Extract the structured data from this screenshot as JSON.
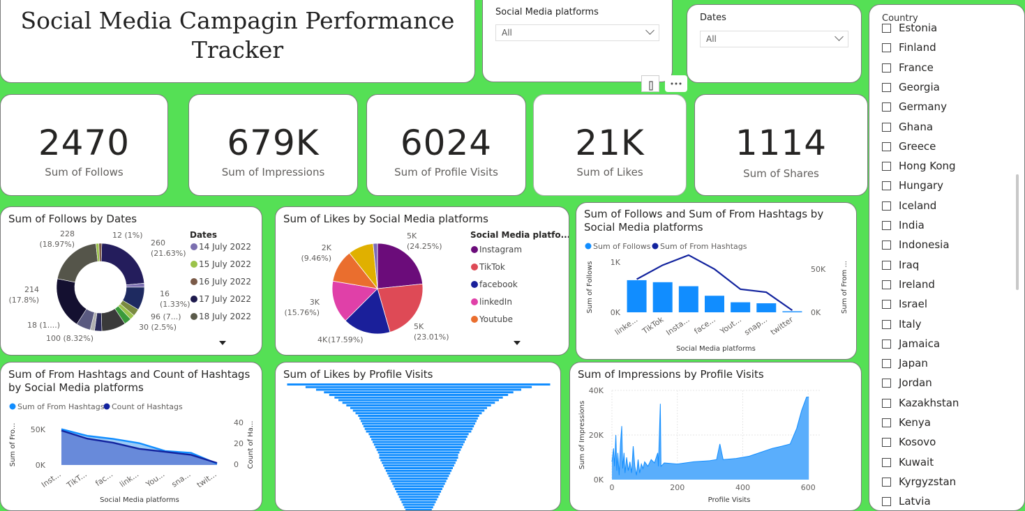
{
  "title": "Social Media Campagin Performance Tracker",
  "title_lines": [
    "Social Media Campagin Performance",
    "Tracker"
  ],
  "slicers": {
    "platforms": {
      "label": "Social Media platforms",
      "value": "All"
    },
    "dates": {
      "label": "Dates",
      "value": "All"
    }
  },
  "kpis": [
    {
      "value": "2470",
      "label": "Sum of Follows"
    },
    {
      "value": "679K",
      "label": "Sum of Impressions"
    },
    {
      "value": "6024",
      "label": "Sum of Profile Visits"
    },
    {
      "value": "21K",
      "label": "Sum of Likes"
    },
    {
      "value": "1114",
      "label": "Sum of Shares"
    }
  ],
  "country": {
    "label": "Country",
    "items": [
      "Estonia",
      "Finland",
      "France",
      "Georgia",
      "Germany",
      "Ghana",
      "Greece",
      "Hong Kong",
      "Hungary",
      "Iceland",
      "India",
      "Indonesia",
      "Iraq",
      "Ireland",
      "Israel",
      "Italy",
      "Jamaica",
      "Japan",
      "Jordan",
      "Kazakhstan",
      "Kenya",
      "Kosovo",
      "Kuwait",
      "Kyrgyzstan",
      "Latvia"
    ]
  },
  "icons": {
    "filter": "filter-icon",
    "more": "more-options-icon",
    "expand": "expand-legend-icon"
  },
  "chart_data": [
    {
      "type": "pie",
      "subtype": "donut",
      "title": "Sum of Follows by Dates",
      "legend_title": "Dates",
      "legend": [
        "14 July 2022",
        "15 July 2022",
        "16 July 2022",
        "17 July 2022",
        "18 July 2022"
      ],
      "colors": {
        "14 July 2022": "#7b6fb0",
        "15 July 2022": "#9bc34a",
        "16 July 2022": "#7a5a48",
        "17 July 2022": "#1e1a4d",
        "18 July 2022": "#5a5a4a"
      },
      "slices": [
        {
          "label": "260",
          "pct": "(21.63%)",
          "value": 260,
          "color": "#241d5c"
        },
        {
          "label": "16",
          "pct": "(1.33%)",
          "value": 16,
          "color": "#7b6fb0"
        },
        {
          "label": "96 (7...)",
          "pct": "",
          "value": 96,
          "color": "#1e2a60"
        },
        {
          "label": "30 (2.5%)",
          "pct": "",
          "value": 30,
          "color": "#7a8a40"
        },
        {
          "label": "",
          "pct": "",
          "value": 20,
          "color": "#9bc34a"
        },
        {
          "label": "",
          "pct": "",
          "value": 30,
          "color": "#3a9a3a"
        },
        {
          "label": "100 (8.32%)",
          "pct": "",
          "value": 100,
          "color": "#3a3a3a"
        },
        {
          "label": "",
          "pct": "",
          "value": 30,
          "color": "#2a2a5a"
        },
        {
          "label": "18 (1....)",
          "pct": "",
          "value": 18,
          "color": "#b0b0b0"
        },
        {
          "label": "",
          "pct": "",
          "value": 60,
          "color": "#5a5a80"
        },
        {
          "label": "214",
          "pct": "(17.8%)",
          "value": 214,
          "color": "#141030"
        },
        {
          "label": "228",
          "pct": "(18.97%)",
          "value": 228,
          "color": "#55554a"
        },
        {
          "label": "",
          "pct": "",
          "value": 12,
          "color": "#9bc34a"
        },
        {
          "label": "12 (1%)",
          "pct": "",
          "value": 12,
          "color": "#7a5a48"
        }
      ]
    },
    {
      "type": "pie",
      "title": "Sum of Likes by Social Media platforms",
      "legend_title": "Social Media platfo...",
      "legend": [
        "Instagram",
        "TikTok",
        "facebook",
        "linkedIn",
        "Youtube"
      ],
      "colors": {
        "Instagram": "#6b0c7a",
        "TikTok": "#de4a56",
        "facebook": "#1a1f9a",
        "linkedIn": "#e040a8",
        "Youtube": "#ea6e2e",
        "snapchat": "#e0b000",
        "twitter": "#7a6ab8"
      },
      "slices": [
        {
          "name": "Instagram",
          "value": 5000,
          "pct": "(24.25%)",
          "label": "5K",
          "color": "#6b0c7a"
        },
        {
          "name": "TikTok",
          "value": 4750,
          "pct": "(23.01%)",
          "label": "5K",
          "color": "#de4a56"
        },
        {
          "name": "facebook",
          "value": 3630,
          "pct": "(17.59%)",
          "label": "4K",
          "color": "#1a1f9a"
        },
        {
          "name": "linkedIn",
          "value": 3250,
          "pct": "(15.76%)",
          "label": "3K",
          "color": "#e040a8"
        },
        {
          "name": "Youtube",
          "value": 2500,
          "pct": "",
          "label": "",
          "color": "#ea6e2e"
        },
        {
          "name": "snapchat",
          "value": 1950,
          "pct": "(9.46%)",
          "label": "2K",
          "color": "#e0b000"
        },
        {
          "name": "twitter",
          "value": 330,
          "pct": "",
          "label": "",
          "color": "#7a6ab8"
        }
      ]
    },
    {
      "type": "bar",
      "title": "Sum of Follows and Sum of From Hashtags by Social Media platforms",
      "title_lines": [
        "Sum of Follows and Sum of From Hashtags by",
        "Social Media platforms"
      ],
      "legend": [
        "Sum of Follows",
        "Sum of From Hashtags"
      ],
      "xlabel": "Social Media platforms",
      "ylabel": "Sum of Follows",
      "y2label": "Sum of From ...",
      "categories": [
        "linke...",
        "TikTok",
        "Insta...",
        "face...",
        "Yout...",
        "snap...",
        "twitter"
      ],
      "y_ticks": [
        "1K",
        "0K"
      ],
      "y2_ticks": [
        "50K",
        "0K"
      ],
      "ylim": [
        0,
        1000
      ],
      "y2lim": [
        0,
        50000
      ],
      "series": [
        {
          "name": "Sum of Follows",
          "type": "bar",
          "values": [
            640,
            600,
            520,
            330,
            200,
            180,
            20
          ],
          "color": "#118dff"
        },
        {
          "name": "Sum of From Hashtags",
          "type": "line",
          "values": [
            33000,
            47000,
            57000,
            43000,
            23000,
            20000,
            2000
          ],
          "color": "#12239e"
        }
      ]
    },
    {
      "type": "area",
      "title": "Sum of From Hashtags and Count of Hashtags by Social Media platforms",
      "title_lines": [
        "Sum of From Hashtags and Count of Hashtags",
        "by Social Media platforms"
      ],
      "legend": [
        "Sum of From Hashtags",
        "Count of Hashtags"
      ],
      "xlabel": "Social Media platforms",
      "ylabel": "Sum of Fro...",
      "y2label": "Count of Ha...",
      "categories": [
        "Inst...",
        "TikT...",
        "fac...",
        "link...",
        "You...",
        "sna...",
        "twit..."
      ],
      "y_ticks": [
        "50K",
        "0K"
      ],
      "y2_ticks": [
        "40",
        "20",
        "0"
      ],
      "ylim": [
        0,
        70000
      ],
      "y2lim": [
        0,
        42
      ],
      "series": [
        {
          "name": "Sum of From Hashtags",
          "values": [
            59000,
            48000,
            43000,
            36000,
            23000,
            20000,
            2000
          ],
          "color": "#118dff"
        },
        {
          "name": "Count of Hashtags",
          "values": [
            34,
            26,
            22,
            16,
            13,
            10,
            2
          ],
          "color": "#12239e"
        }
      ]
    },
    {
      "type": "bar",
      "subtype": "funnel",
      "title": "Sum of Likes by Profile Visits",
      "bar_color": "#118dff",
      "widths": [
        1.0,
        0.86,
        0.78,
        0.72,
        0.68,
        0.64,
        0.61,
        0.58,
        0.55,
        0.52,
        0.5,
        0.48,
        0.46,
        0.45,
        0.44,
        0.43,
        0.42,
        0.41,
        0.4,
        0.38,
        0.37,
        0.36,
        0.35,
        0.34,
        0.33,
        0.32,
        0.31,
        0.3,
        0.3,
        0.29,
        0.28,
        0.27,
        0.26,
        0.25,
        0.24,
        0.23,
        0.22,
        0.21,
        0.2,
        0.19,
        0.18,
        0.17,
        0.16,
        0.15,
        0.14,
        0.13,
        0.12,
        0.11,
        0.1,
        0.09,
        0.09,
        0.08,
        0.08,
        0.08
      ]
    },
    {
      "type": "area",
      "title": "Sum of Impressions by Profile Visits",
      "xlabel": "Profile Visits",
      "ylabel": "Sum of Impressions",
      "x_ticks": [
        "0",
        "200",
        "400",
        "600"
      ],
      "y_ticks": [
        "40K",
        "20K",
        "0K"
      ],
      "xlim": [
        0,
        640
      ],
      "ylim": [
        0,
        40000
      ],
      "color": "#118dff",
      "points": [
        [
          0,
          8000
        ],
        [
          5,
          14000
        ],
        [
          8,
          6000
        ],
        [
          12,
          20000
        ],
        [
          15,
          4000
        ],
        [
          18,
          12000
        ],
        [
          22,
          2000
        ],
        [
          26,
          16000
        ],
        [
          30,
          24000
        ],
        [
          33,
          5000
        ],
        [
          37,
          12000
        ],
        [
          40,
          3000
        ],
        [
          45,
          10000
        ],
        [
          50,
          4000
        ],
        [
          55,
          8000
        ],
        [
          60,
          3000
        ],
        [
          65,
          15000
        ],
        [
          70,
          6000
        ],
        [
          75,
          2000
        ],
        [
          80,
          9000
        ],
        [
          85,
          3000
        ],
        [
          90,
          7000
        ],
        [
          95,
          5000
        ],
        [
          100,
          8000
        ],
        [
          110,
          6000
        ],
        [
          120,
          9000
        ],
        [
          130,
          7500
        ],
        [
          140,
          12000
        ],
        [
          142,
          6000
        ],
        [
          148,
          34000
        ],
        [
          150,
          6000
        ],
        [
          160,
          7500
        ],
        [
          200,
          7000
        ],
        [
          250,
          8000
        ],
        [
          300,
          8500
        ],
        [
          320,
          9000
        ],
        [
          330,
          16000
        ],
        [
          340,
          9000
        ],
        [
          380,
          9500
        ],
        [
          420,
          10500
        ],
        [
          460,
          12500
        ],
        [
          490,
          14000
        ],
        [
          520,
          15000
        ],
        [
          545,
          16000
        ],
        [
          565,
          23000
        ],
        [
          580,
          31000
        ],
        [
          595,
          37000
        ],
        [
          602,
          37000
        ]
      ]
    }
  ]
}
